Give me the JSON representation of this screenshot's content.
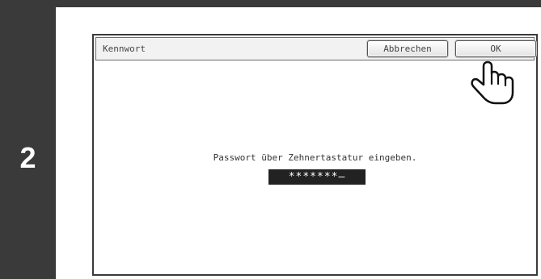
{
  "step": {
    "number": "2"
  },
  "dialog": {
    "title": "Kennwort",
    "cancel_label": "Abbrechen",
    "ok_label": "OK"
  },
  "main": {
    "prompt": "Passwort über Zehnertastatur eingeben.",
    "password_display": "*******—"
  },
  "icons": {
    "pointer": "pointing-hand-icon"
  },
  "colors": {
    "step_bar": "#3a3a3a",
    "password_field": "#222222"
  }
}
